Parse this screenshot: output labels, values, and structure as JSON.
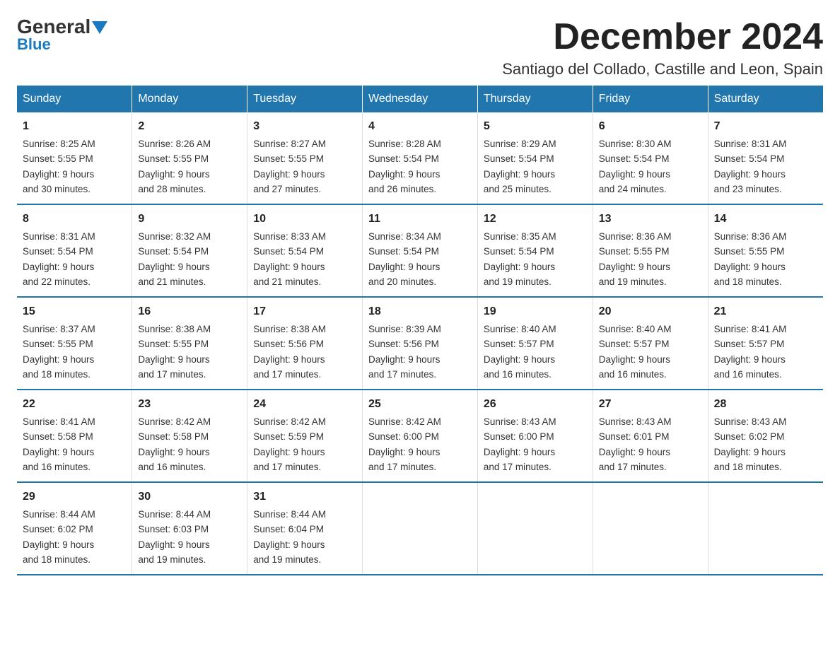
{
  "logo": {
    "general": "General",
    "blue": "Blue"
  },
  "header": {
    "title": "December 2024",
    "subtitle": "Santiago del Collado, Castille and Leon, Spain"
  },
  "days_of_week": [
    "Sunday",
    "Monday",
    "Tuesday",
    "Wednesday",
    "Thursday",
    "Friday",
    "Saturday"
  ],
  "weeks": [
    [
      {
        "day": "1",
        "sunrise": "8:25 AM",
        "sunset": "5:55 PM",
        "daylight": "9 hours and 30 minutes."
      },
      {
        "day": "2",
        "sunrise": "8:26 AM",
        "sunset": "5:55 PM",
        "daylight": "9 hours and 28 minutes."
      },
      {
        "day": "3",
        "sunrise": "8:27 AM",
        "sunset": "5:55 PM",
        "daylight": "9 hours and 27 minutes."
      },
      {
        "day": "4",
        "sunrise": "8:28 AM",
        "sunset": "5:54 PM",
        "daylight": "9 hours and 26 minutes."
      },
      {
        "day": "5",
        "sunrise": "8:29 AM",
        "sunset": "5:54 PM",
        "daylight": "9 hours and 25 minutes."
      },
      {
        "day": "6",
        "sunrise": "8:30 AM",
        "sunset": "5:54 PM",
        "daylight": "9 hours and 24 minutes."
      },
      {
        "day": "7",
        "sunrise": "8:31 AM",
        "sunset": "5:54 PM",
        "daylight": "9 hours and 23 minutes."
      }
    ],
    [
      {
        "day": "8",
        "sunrise": "8:31 AM",
        "sunset": "5:54 PM",
        "daylight": "9 hours and 22 minutes."
      },
      {
        "day": "9",
        "sunrise": "8:32 AM",
        "sunset": "5:54 PM",
        "daylight": "9 hours and 21 minutes."
      },
      {
        "day": "10",
        "sunrise": "8:33 AM",
        "sunset": "5:54 PM",
        "daylight": "9 hours and 21 minutes."
      },
      {
        "day": "11",
        "sunrise": "8:34 AM",
        "sunset": "5:54 PM",
        "daylight": "9 hours and 20 minutes."
      },
      {
        "day": "12",
        "sunrise": "8:35 AM",
        "sunset": "5:54 PM",
        "daylight": "9 hours and 19 minutes."
      },
      {
        "day": "13",
        "sunrise": "8:36 AM",
        "sunset": "5:55 PM",
        "daylight": "9 hours and 19 minutes."
      },
      {
        "day": "14",
        "sunrise": "8:36 AM",
        "sunset": "5:55 PM",
        "daylight": "9 hours and 18 minutes."
      }
    ],
    [
      {
        "day": "15",
        "sunrise": "8:37 AM",
        "sunset": "5:55 PM",
        "daylight": "9 hours and 18 minutes."
      },
      {
        "day": "16",
        "sunrise": "8:38 AM",
        "sunset": "5:55 PM",
        "daylight": "9 hours and 17 minutes."
      },
      {
        "day": "17",
        "sunrise": "8:38 AM",
        "sunset": "5:56 PM",
        "daylight": "9 hours and 17 minutes."
      },
      {
        "day": "18",
        "sunrise": "8:39 AM",
        "sunset": "5:56 PM",
        "daylight": "9 hours and 17 minutes."
      },
      {
        "day": "19",
        "sunrise": "8:40 AM",
        "sunset": "5:57 PM",
        "daylight": "9 hours and 16 minutes."
      },
      {
        "day": "20",
        "sunrise": "8:40 AM",
        "sunset": "5:57 PM",
        "daylight": "9 hours and 16 minutes."
      },
      {
        "day": "21",
        "sunrise": "8:41 AM",
        "sunset": "5:57 PM",
        "daylight": "9 hours and 16 minutes."
      }
    ],
    [
      {
        "day": "22",
        "sunrise": "8:41 AM",
        "sunset": "5:58 PM",
        "daylight": "9 hours and 16 minutes."
      },
      {
        "day": "23",
        "sunrise": "8:42 AM",
        "sunset": "5:58 PM",
        "daylight": "9 hours and 16 minutes."
      },
      {
        "day": "24",
        "sunrise": "8:42 AM",
        "sunset": "5:59 PM",
        "daylight": "9 hours and 17 minutes."
      },
      {
        "day": "25",
        "sunrise": "8:42 AM",
        "sunset": "6:00 PM",
        "daylight": "9 hours and 17 minutes."
      },
      {
        "day": "26",
        "sunrise": "8:43 AM",
        "sunset": "6:00 PM",
        "daylight": "9 hours and 17 minutes."
      },
      {
        "day": "27",
        "sunrise": "8:43 AM",
        "sunset": "6:01 PM",
        "daylight": "9 hours and 17 minutes."
      },
      {
        "day": "28",
        "sunrise": "8:43 AM",
        "sunset": "6:02 PM",
        "daylight": "9 hours and 18 minutes."
      }
    ],
    [
      {
        "day": "29",
        "sunrise": "8:44 AM",
        "sunset": "6:02 PM",
        "daylight": "9 hours and 18 minutes."
      },
      {
        "day": "30",
        "sunrise": "8:44 AM",
        "sunset": "6:03 PM",
        "daylight": "9 hours and 19 minutes."
      },
      {
        "day": "31",
        "sunrise": "8:44 AM",
        "sunset": "6:04 PM",
        "daylight": "9 hours and 19 minutes."
      },
      null,
      null,
      null,
      null
    ]
  ],
  "labels": {
    "sunrise": "Sunrise:",
    "sunset": "Sunset:",
    "daylight": "Daylight:"
  }
}
